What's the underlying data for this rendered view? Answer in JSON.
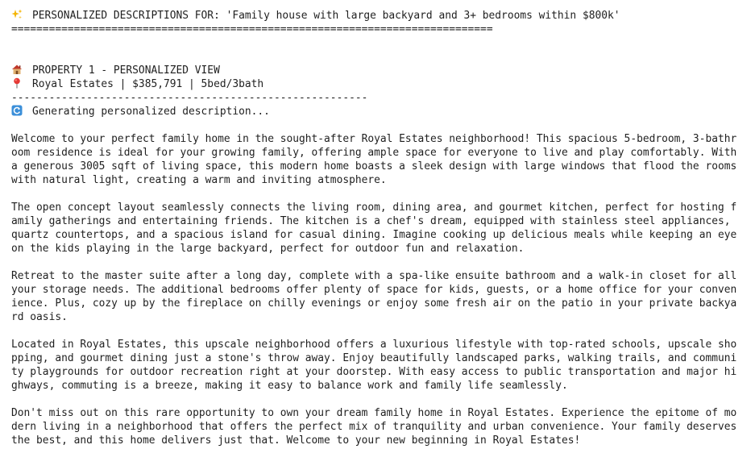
{
  "header": {
    "title_line": "PERSONALIZED DESCRIPTIONS FOR: 'Family house with large backyard and 3+ bedrooms within $800k'",
    "separator_line": "============================================================================="
  },
  "property": {
    "heading": "PROPERTY 1 - PERSONALIZED VIEW",
    "summary": "Royal Estates | $385,791 | 5bed/3bath",
    "separator_line": "---------------------------------------------------------",
    "status": "Generating personalized description..."
  },
  "description": {
    "paragraphs": [
      {
        "lines": [
          "Welcome to your perfect family home in the sought-after Royal Estates neighborhood! This spacious 5-bedroom, 3-bathr",
          "oom residence is ideal for your growing family, offering ample space for everyone to live and play comfortably. With",
          "a generous 3005 sqft of living space, this modern home boasts a sleek design with large windows that flood the rooms",
          "with natural light, creating a warm and inviting atmosphere."
        ]
      },
      {
        "lines": [
          "The open concept layout seamlessly connects the living room, dining area, and gourmet kitchen, perfect for hosting f",
          "amily gatherings and entertaining friends. The kitchen is a chef's dream, equipped with stainless steel appliances,",
          "quartz countertops, and a spacious island for casual dining. Imagine cooking up delicious meals while keeping an eye",
          "on the kids playing in the large backyard, perfect for outdoor fun and relaxation."
        ]
      },
      {
        "lines": [
          "Retreat to the master suite after a long day, complete with a spa-like ensuite bathroom and a walk-in closet for all",
          "your storage needs. The additional bedrooms offer plenty of space for kids, guests, or a home office for your conven",
          "ience. Plus, cozy up by the fireplace on chilly evenings or enjoy some fresh air on the patio in your private backya",
          "rd oasis."
        ]
      },
      {
        "lines": [
          "Located in Royal Estates, this upscale neighborhood offers a luxurious lifestyle with top-rated schools, upscale sho",
          "pping, and gourmet dining just a stone's throw away. Enjoy beautifully landscaped parks, walking trails, and communi",
          "ty playgrounds for outdoor recreation right at your doorstep. With easy access to public transportation and major hi",
          "ghways, commuting is a breeze, making it easy to balance work and family life seamlessly."
        ]
      },
      {
        "lines": [
          "Don't miss out on this rare opportunity to own your dream family home in Royal Estates. Experience the epitome of mo",
          "dern living in a neighborhood that offers the perfect mix of tranquility and urban convenience. Your family deserves",
          "the best, and this home delivers just that. Welcome to your new beginning in Royal Estates!"
        ]
      }
    ]
  },
  "icons": {
    "sparkles": "sparkles-icon",
    "house": "house-icon",
    "pin": "round-pushpin-icon",
    "refresh": "refresh-icon"
  }
}
